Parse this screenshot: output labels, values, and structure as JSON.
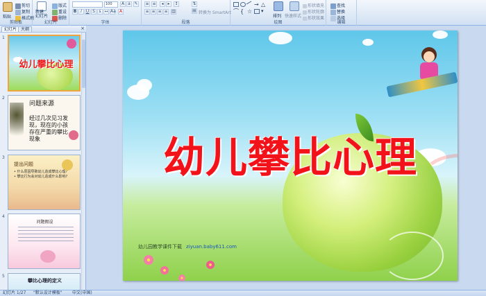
{
  "ribbon": {
    "clipboard": {
      "paste": "粘贴",
      "cut": "剪切",
      "copy": "复制",
      "format_painter": "格式刷",
      "group": "剪贴板"
    },
    "slides": {
      "new_slide": "新建",
      "new_slide_2": "幻灯片",
      "layout": "版式",
      "reset": "重设",
      "delete": "删除",
      "group": "幻灯片"
    },
    "font": {
      "font_size": "100",
      "group": "字体"
    },
    "paragraph": {
      "convert_smartart": "转换为 SmartArt",
      "group": "段落"
    },
    "drawing": {
      "arrange": "排列",
      "quick_styles": "快速样式",
      "shape_fill": "形状填充",
      "shape_outline": "形状轮廓",
      "shape_effects": "形状效果",
      "group": "绘图"
    },
    "editing": {
      "find": "查找",
      "replace": "替换",
      "select": "选择",
      "group": "编辑"
    }
  },
  "pane": {
    "tabs": [
      "幻灯片",
      "大纲"
    ],
    "close": "×",
    "thumbnails": [
      {
        "num": "1",
        "title": "幼儿攀比心理"
      },
      {
        "num": "2",
        "title": "问题来源",
        "body": "经过几次见习发现，现在的小孩存在严重的攀比现象"
      },
      {
        "num": "3",
        "title": "提出问题",
        "lines": [
          "• 什么原因导致幼儿造成攀比心理?",
          "• 攀比行为会对幼儿造成什么影响?"
        ]
      },
      {
        "num": "4",
        "title": "问题假设"
      },
      {
        "num": "5",
        "title": "攀比心理的定义"
      }
    ]
  },
  "slide": {
    "title": "幼儿攀比心理",
    "footer": "幼儿园教学课件下载",
    "footer_url": "ziyuan.baby611.com"
  },
  "status": {
    "slide_info": "幻灯片 1/27",
    "theme": "\"默认设计模板\"",
    "language": "中文(中国)"
  }
}
